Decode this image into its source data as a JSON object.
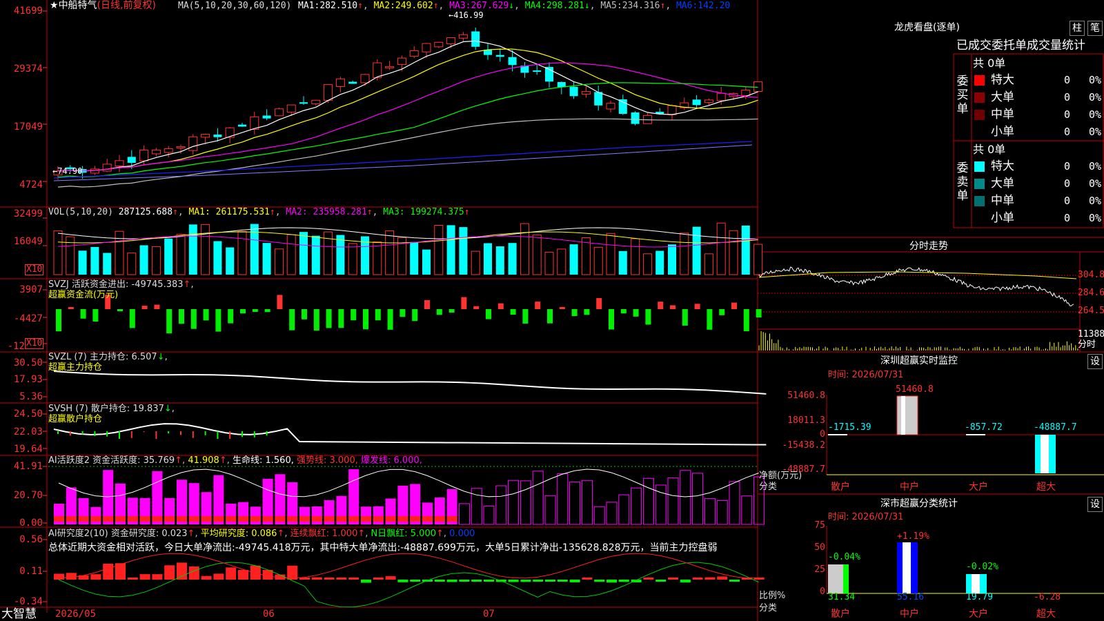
{
  "colors": {
    "up": "#ff3232",
    "down": "#00ffff",
    "grid": "#b00000",
    "bg": "#000000",
    "yellow": "#ffff00",
    "magenta": "#ff00ff",
    "green": "#00ff00"
  },
  "main": {
    "title": "中船特气",
    "mode": "(日线,前复权)",
    "ma_header": "MA(5,10,20,30,60,120)",
    "ma": [
      {
        "label": "MA1:",
        "value": "282.510",
        "arrow": "↑"
      },
      {
        "label": "MA2:",
        "value": "249.602",
        "arrow": "↑"
      },
      {
        "label": "MA3:",
        "value": "267.629",
        "arrow": "↓"
      },
      {
        "label": "MA4:",
        "value": "298.281",
        "arrow": "↓"
      },
      {
        "label": "MA5:",
        "value": "234.316",
        "arrow": "↑"
      },
      {
        "label": "MA6:",
        "value": "142.20",
        "arrow": ""
      }
    ],
    "axis": [
      "41699",
      "29374",
      "17049",
      "4724"
    ],
    "high_mark": "416.99",
    "low_mark": "74.90"
  },
  "vol": {
    "header": "VOL(5,10,20)",
    "value": "287125.688",
    "ma1": "MA1: 261175.531",
    "ma2": "MA2: 235958.281",
    "ma3": "MA3: 199274.375",
    "axis": [
      "32499",
      "16049"
    ],
    "unit": "X10"
  },
  "svzj": {
    "header": "SVZJ  活跃资金进出: -49745.383",
    "sub": "超赢资金流(万元)",
    "axis": [
      "3907",
      "-4427",
      "-12"
    ],
    "unit": "X10"
  },
  "svzl": {
    "header": "SVZL (7) 主力持仓: 6.507",
    "sub": "超赢主力持仓",
    "axis": [
      "30.50",
      "17.93",
      "5.36"
    ]
  },
  "svsh": {
    "header": "SVSH (7) 散户持仓: 19.837",
    "sub": "超赢散户持仓",
    "axis": [
      "24.50",
      "22.03",
      "19.64"
    ]
  },
  "ai1": {
    "header": "AI活跃度2 资金活跃度: 35.769",
    "v2": "41.908",
    "life": "生命线: 1.560,",
    "strong": "强势线: 3.000,",
    "burst": "爆发线: 6.000,",
    "axis": [
      "41.91",
      "20.70",
      "0.00"
    ]
  },
  "ai2": {
    "header": "AI研究度2(10) 资金研究度: 0.023",
    "avg": "平均研究度: 0.086",
    "red": "连续飘红: 1.000",
    "nred": "N日飘红: 5.000",
    "last": "0.000",
    "summary": "总体近期大资金相对活跃，今日大单净流出:-49745.418万元，其中特大单净流出:-48887.699万元，大单5日累计净出-135628.828万元，当前主力控盘弱",
    "axis": [
      "0.56",
      "0.11",
      "-0.34"
    ]
  },
  "footer": {
    "brand": "大智慧",
    "dates": [
      "2026/05",
      "06",
      "07"
    ]
  },
  "right": {
    "lhb_title": "龙虎看盘(逐单)",
    "tab1": "柱",
    "tab2": "笔",
    "table_title": "已成交委托单成交量统计",
    "buy_label": "委买单",
    "sell_label": "委卖单",
    "buy_total": "共 0单",
    "sell_total": "共 0单",
    "buy_rows": [
      {
        "name": "特大",
        "count": "0",
        "pct": "0%",
        "color": "#ff0000"
      },
      {
        "name": "大单",
        "count": "0",
        "pct": "0%",
        "color": "#8b0000"
      },
      {
        "name": "中单",
        "count": "0",
        "pct": "0%",
        "color": "#700000"
      },
      {
        "name": "小单",
        "count": "0",
        "pct": "0%",
        "color": ""
      }
    ],
    "sell_rows": [
      {
        "name": "特大",
        "count": "0",
        "pct": "0%",
        "color": "#00ffff"
      },
      {
        "name": "大单",
        "count": "0",
        "pct": "0%",
        "color": "#008b8b"
      },
      {
        "name": "中单",
        "count": "0",
        "pct": "0%",
        "color": "#007070"
      },
      {
        "name": "小单",
        "count": "0",
        "pct": "0%",
        "color": ""
      }
    ],
    "intraday_title": "分时走势",
    "intraday_axis": [
      "304.8",
      "284.6",
      "264.5",
      "11388",
      "分时"
    ],
    "monitor_title": "深圳超赢实时监控",
    "monitor_set": "设",
    "monitor_time": "时间: 2026/07/31",
    "monitor_axis": [
      "51460.8",
      "18011.3",
      "0",
      "-15438.2",
      "-48887.7"
    ],
    "monitor_unit": "净额(万元)",
    "monitor_cat": "分类",
    "monitor_values": [
      "-1715.39",
      "51460.8",
      "-857.72",
      "-48887.7"
    ],
    "monitor_cats": [
      "散户",
      "中户",
      "大户",
      "超大"
    ],
    "stat_title": "深市超赢分类统计",
    "stat_set": "设",
    "stat_time": "时间: 2026/07/31",
    "stat_axis": [
      "75",
      "50",
      "25",
      "0"
    ],
    "stat_unit": "比例%",
    "stat_cat": "分类",
    "stat_top": [
      "-0.04%",
      "+1.19%",
      "-0.02%",
      ""
    ],
    "stat_bottom": [
      "31.34",
      "55.16",
      "19.79",
      "-6.28"
    ],
    "stat_cats": [
      "散户",
      "中户",
      "大户",
      "超大"
    ]
  }
}
